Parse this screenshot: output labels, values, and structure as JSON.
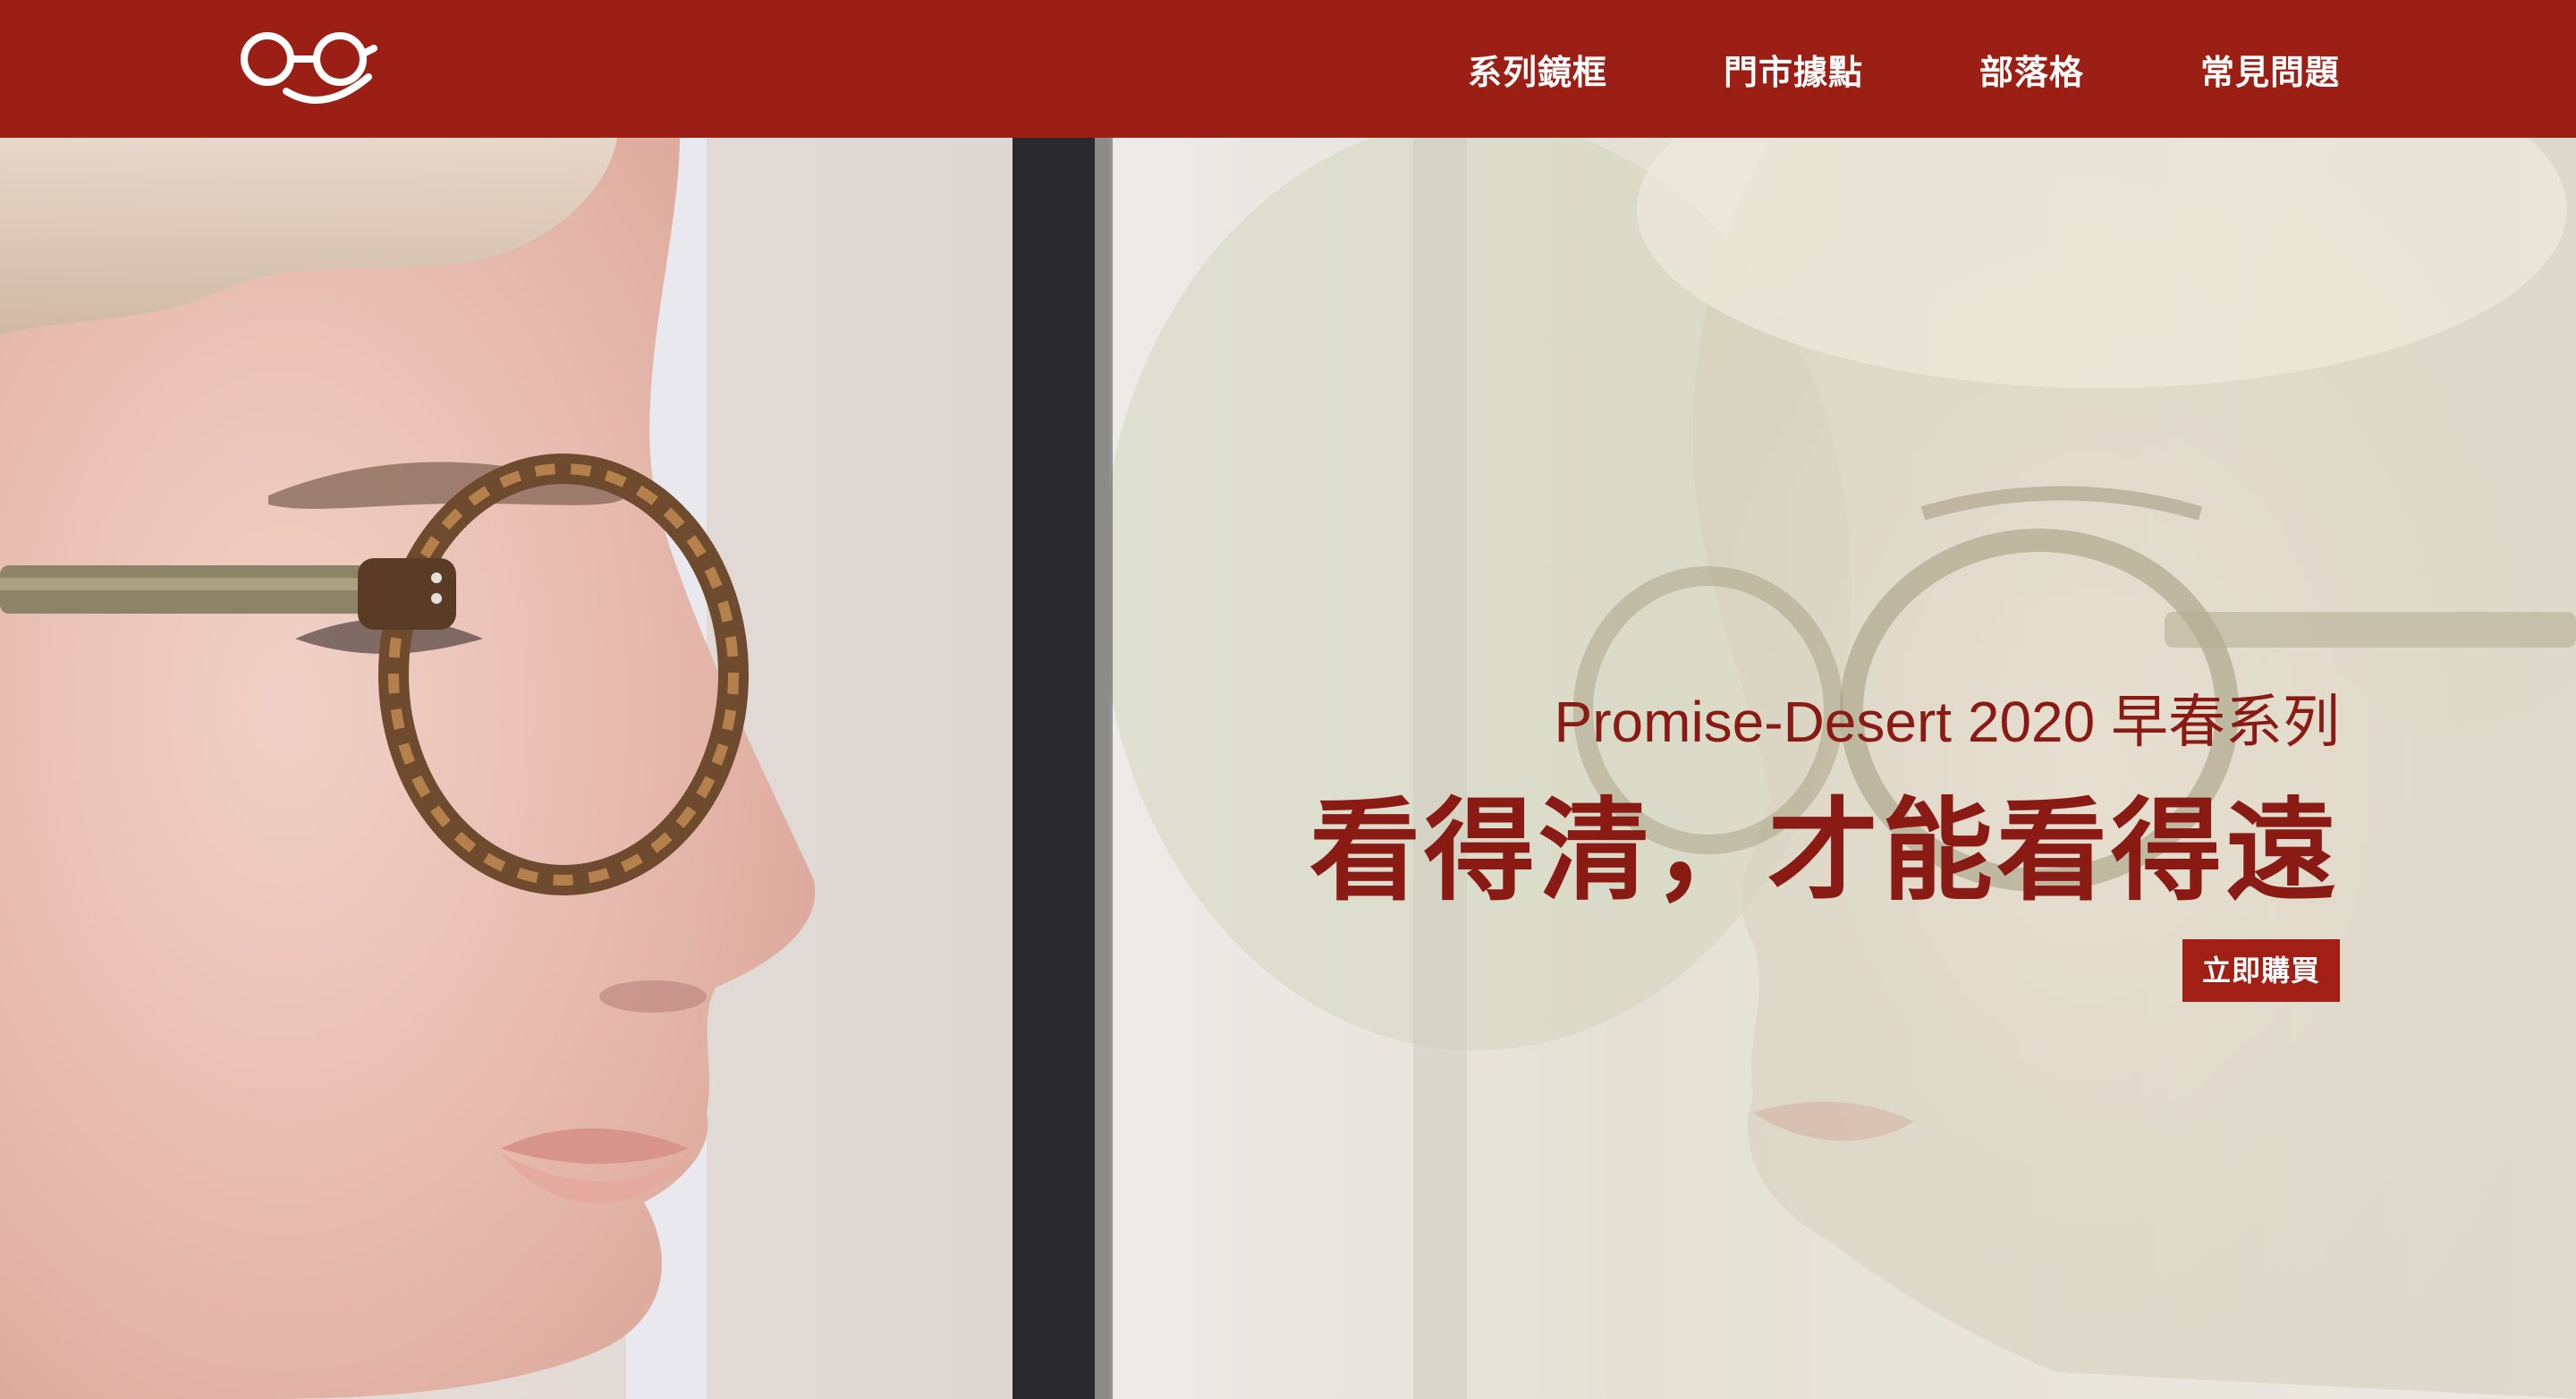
{
  "brand": {
    "logo_icon": "glasses-smile-logo-icon",
    "color_primary": "#9c1f16",
    "color_accent_text": "#8a1a14"
  },
  "nav": {
    "items": [
      {
        "label": "系列鏡框"
      },
      {
        "label": "門市據點"
      },
      {
        "label": "部落格"
      },
      {
        "label": "常見問題"
      }
    ]
  },
  "hero": {
    "subtitle": "Promise-Desert 2020 早春系列",
    "title": "看得清，才能看得遠",
    "cta_label": "立即購買",
    "image_alt_icon": "person-with-glasses-reflection-image"
  }
}
